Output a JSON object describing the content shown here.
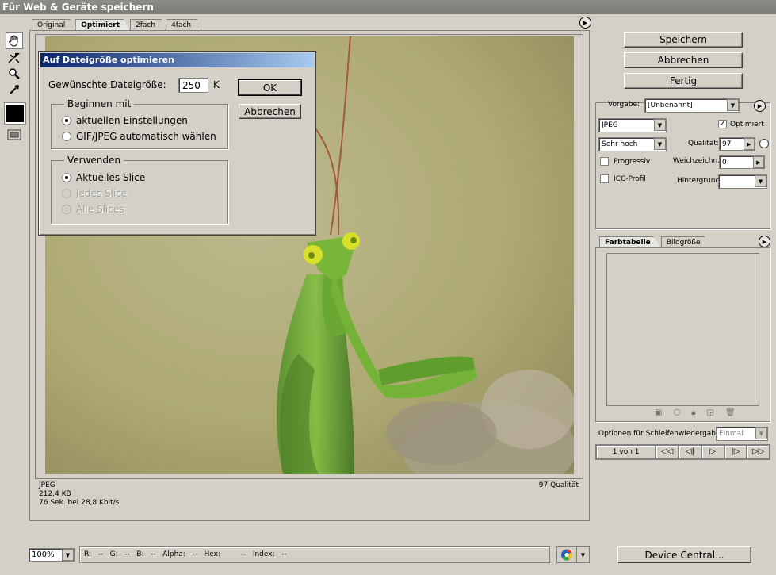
{
  "window": {
    "title": "Für Web & Geräte speichern"
  },
  "tabs": [
    {
      "label": "Original"
    },
    {
      "label": "Optimiert"
    },
    {
      "label": "2fach"
    },
    {
      "label": "4fach"
    }
  ],
  "icons": {
    "hand": "hand-icon",
    "slice_select": "slice-select-icon",
    "zoom": "zoom-icon",
    "eyedropper": "eyedropper-icon",
    "preview_toggle": "toggle-slices-icon",
    "menu": "flyout-menu-icon",
    "browser": "browser-preview-icon"
  },
  "image_info": {
    "format": "JPEG",
    "size": "212,4 KB",
    "time": "76 Sek. bei 28,8 Kbit/s",
    "quality": "97 Qualität"
  },
  "dialog": {
    "title": "Auf Dateigröße optimieren",
    "size_label": "Gewünschte Dateigröße:",
    "size_value": "250",
    "size_unit": "K",
    "ok_label": "OK",
    "cancel_label": "Abbrechen",
    "group_start": {
      "legend": "Beginnen mit",
      "options": [
        "aktuellen Einstellungen",
        "GIF/JPEG automatisch wählen"
      ],
      "selected": "aktuellen Einstellungen"
    },
    "group_use": {
      "legend": "Verwenden",
      "options": [
        "Aktuelles Slice",
        "Jedes Slice",
        "Alle Slices"
      ],
      "selected": "Aktuelles Slice"
    }
  },
  "actions": {
    "save": "Speichern",
    "cancel": "Abbrechen",
    "done": "Fertig"
  },
  "settings": {
    "preset_label": "Vorgabe:",
    "preset_value": "[Unbenannt]",
    "format_value": "JPEG",
    "optimized_label": "Optimiert",
    "optimized_checked": true,
    "quality_preset": "Sehr hoch",
    "quality_label": "Qualität:",
    "quality_value": "97",
    "progressive_label": "Progressiv",
    "blur_label": "Weichzeichn.:",
    "blur_value": "0",
    "icc_label": "ICC-Profil",
    "matte_label": "Hintergrund:"
  },
  "color_table": {
    "tabs": [
      "Farbtabelle",
      "Bildgröße"
    ]
  },
  "animation": {
    "loop_label": "Optionen für Schleifenwiedergabe:",
    "loop_value": "Einmal",
    "frame_label": "1 von 1"
  },
  "statusbar": {
    "zoom": "100%",
    "readout": "R:   --   G:   --   B:   --   Alpha:   --   Hex:         --   Index:   --"
  },
  "device_central": "Device Central..."
}
